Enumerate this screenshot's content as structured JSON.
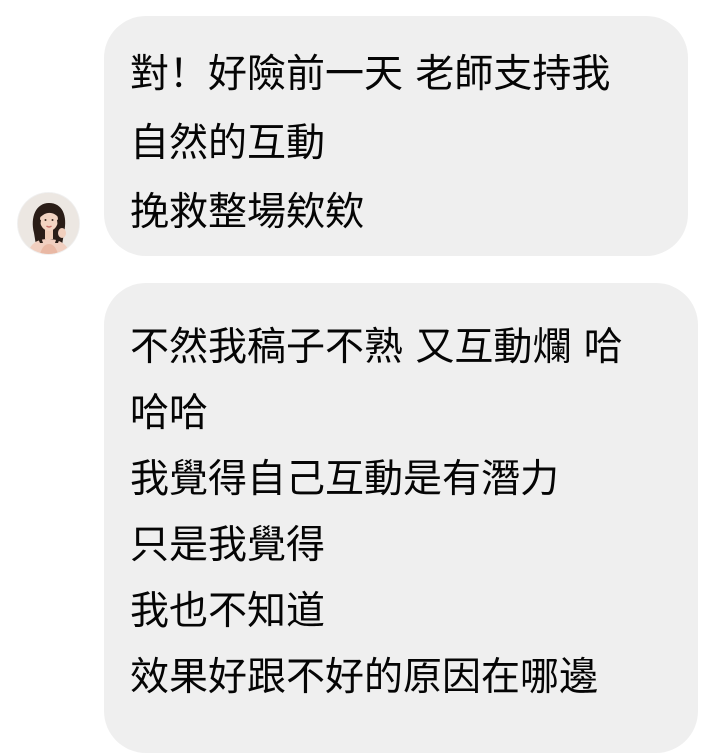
{
  "conversation": {
    "contact_avatar_icon": "contact-avatar-photo",
    "bubble_color": "#efefef",
    "text_color": "#050505",
    "messages": [
      {
        "lines": [
          "對！好險前一天 老師支持我",
          "自然的互動",
          "挽救整場欸欸"
        ]
      },
      {
        "lines": [
          "不然我稿子不熟 又互動爛 哈",
          "哈哈",
          "我覺得自己互動是有潛力",
          "只是我覺得",
          "我也不知道",
          "效果好跟不好的原因在哪邊"
        ]
      }
    ]
  }
}
